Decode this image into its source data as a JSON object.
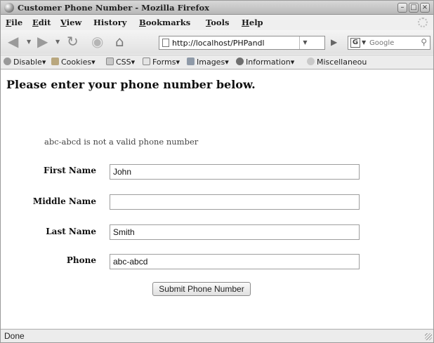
{
  "window": {
    "title": "Customer Phone Number - Mozilla Firefox",
    "minimize_glyph": "–",
    "maximize_glyph": "□",
    "close_glyph": "×"
  },
  "menu": [
    {
      "first": "F",
      "rest": "ile"
    },
    {
      "first": "E",
      "rest": "dit"
    },
    {
      "first": "V",
      "rest": "iew"
    },
    {
      "first": "",
      "rest": "History"
    },
    {
      "first": "B",
      "rest": "ookmarks"
    },
    {
      "first": "T",
      "rest": "ools"
    },
    {
      "first": "H",
      "rest": "elp"
    }
  ],
  "navigation": {
    "back_glyph": "◀",
    "forward_glyph": "▶",
    "reload_glyph": "↻",
    "stop_glyph": "◉",
    "home_glyph": "⌂",
    "url": "http://localhost/PHPandl",
    "search_placeholder": "Google",
    "search_engine_letter": "G"
  },
  "dev_toolbar": [
    "Disable",
    "Cookies",
    "CSS",
    "Forms",
    "Images",
    "Information",
    "Miscellaneou"
  ],
  "page": {
    "heading": "Please enter your phone number below.",
    "error_message": "abc-abcd is not a valid phone number",
    "fields": {
      "first_name": {
        "label": "First Name",
        "value": "John"
      },
      "middle_name": {
        "label": "Middle Name",
        "value": ""
      },
      "last_name": {
        "label": "Last Name",
        "value": "Smith"
      },
      "phone": {
        "label": "Phone",
        "value": "abc-abcd"
      }
    },
    "submit_label": "Submit Phone Number"
  },
  "status": {
    "text": "Done"
  },
  "colors": {
    "titlebar": "#c8c8c8",
    "content_background": "#ffffff",
    "heading_text": "#111111"
  }
}
